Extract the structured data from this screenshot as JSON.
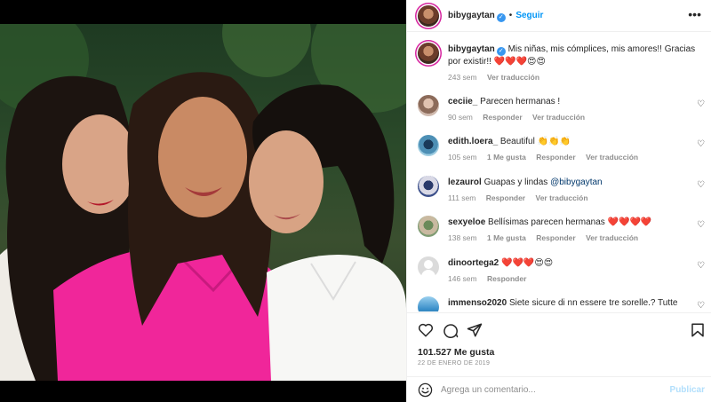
{
  "post": {
    "username": "bibygaytan",
    "follow_label": "Seguir",
    "more_icon": "more-horizontal-icon",
    "caption": "Mis niñas, mis cómplices, mis amores!! Gracias por existir!! ❤️❤️❤️😍😍",
    "caption_age": "243 sem",
    "caption_translate": "Ver traducción",
    "likes": "101.527 Me gusta",
    "date": "22 DE ENERO DE 2019",
    "comment_placeholder": "Agrega un comentario...",
    "publish_label": "Publicar"
  },
  "comments": [
    {
      "username": "ceciie_",
      "text": "Parecen hermanas !",
      "age": "90 sem",
      "likes": "",
      "reply": "Responder",
      "translate": "Ver traducción"
    },
    {
      "username": "edith.loera_",
      "text": "Beautiful 👏👏👏",
      "age": "105 sem",
      "likes": "1 Me gusta",
      "reply": "Responder",
      "translate": "Ver traducción"
    },
    {
      "username": "lezaurol",
      "text": "Guapas y lindas ",
      "mention": "@bibygaytan",
      "age": "111 sem",
      "likes": "",
      "reply": "Responder",
      "translate": "Ver traducción"
    },
    {
      "username": "sexyeloe",
      "text": "Bellísimas parecen hermanas ❤️❤️❤️❤️",
      "age": "138 sem",
      "likes": "1 Me gusta",
      "reply": "Responder",
      "translate": "Ver traducción"
    },
    {
      "username": "dinoortega2",
      "text": "❤️❤️❤️😍😍",
      "age": "146 sem",
      "likes": "",
      "reply": "Responder",
      "translate": ""
    },
    {
      "username": "immenso2020",
      "text": "Siete sicure di nn essere tre sorelle.? Tutte",
      "age": "",
      "likes": "",
      "reply": "",
      "translate": ""
    }
  ],
  "icons": {
    "like": "heart-icon",
    "comment": "comment-icon",
    "share": "send-icon",
    "save": "bookmark-icon",
    "emoji": "emoji-icon"
  },
  "colors": {
    "accent": "#0095f6",
    "publish_disabled": "#b2dffc",
    "muted": "#8e8e8e",
    "verified": "#3897f0"
  }
}
